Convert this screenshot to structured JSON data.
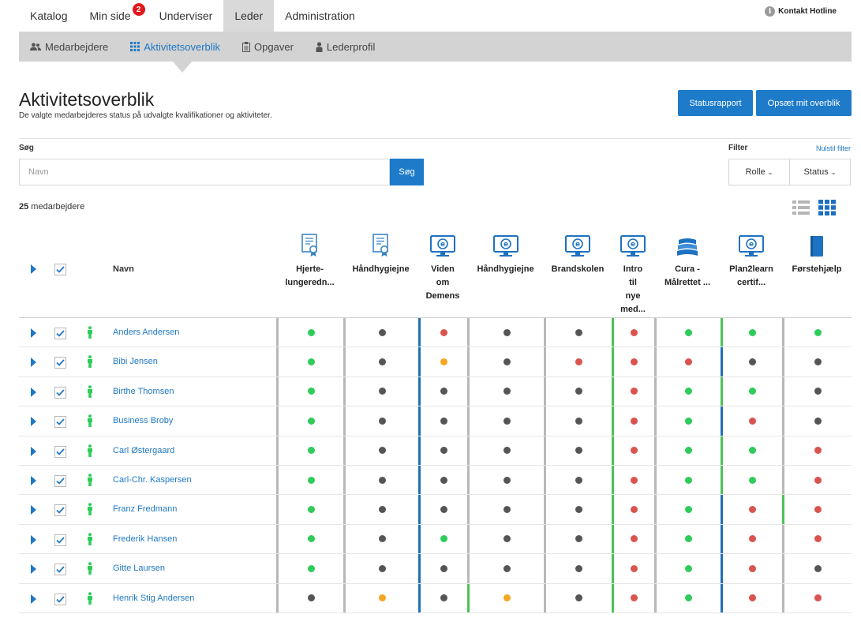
{
  "topnav": {
    "tabs": [
      {
        "label": "Katalog"
      },
      {
        "label": "Min side",
        "badge": "2"
      },
      {
        "label": "Underviser"
      },
      {
        "label": "Leder",
        "active": true
      },
      {
        "label": "Administration"
      }
    ],
    "hotline": "Kontakt Hotline"
  },
  "subnav": {
    "items": [
      {
        "label": "Medarbejdere",
        "icon": "users-icon"
      },
      {
        "label": "Aktivitetsoverblik",
        "icon": "grid-icon",
        "active": true
      },
      {
        "label": "Opgaver",
        "icon": "clipboard-icon"
      },
      {
        "label": "Lederprofil",
        "icon": "user-icon"
      }
    ]
  },
  "header": {
    "title": "Aktivitetsoverblik",
    "subtitle": "De valgte medarbejderes status på udvalgte kvalifikationer og aktiviteter.",
    "status_report": "Statusrapport",
    "setup_overview": "Opsæt mit overblik"
  },
  "search": {
    "label": "Søg",
    "placeholder": "Navn",
    "button": "Søg"
  },
  "filter": {
    "label": "Filter",
    "reset": "Nulstil filter",
    "role": "Rolle",
    "status": "Status"
  },
  "count": {
    "number": "25",
    "text": " medarbejdere"
  },
  "colors": {
    "green": "#2ecc5a",
    "red": "#d9534f",
    "gray": "#555555",
    "orange": "#f5a623",
    "border_gray": "#b8b8b8",
    "border_blue": "#1f6fb5",
    "border_green": "#4cc257",
    "accent": "#1d7bc9"
  },
  "table": {
    "name_header": "Navn",
    "columns": [
      {
        "label": "Hjerte-\nlungeredn...",
        "icon": "certificate-icon"
      },
      {
        "label": "Håndhygiejne",
        "icon": "certificate-icon"
      },
      {
        "label": "Viden\nom\nDemens",
        "icon": "elearning-icon"
      },
      {
        "label": "Håndhygiejne",
        "icon": "elearning-icon"
      },
      {
        "label": "Brandskolen",
        "icon": "elearning-icon"
      },
      {
        "label": "Intro\ntil\nnye\nmed...",
        "icon": "elearning-icon"
      },
      {
        "label": "Cura -\nMålrettet ...",
        "icon": "books-icon"
      },
      {
        "label": "Plan2learn\ncertif...",
        "icon": "elearning-icon"
      },
      {
        "label": "Førstehjælp",
        "icon": "book-icon"
      }
    ],
    "rows": [
      {
        "name": "Anders Andersen",
        "cells": [
          "green",
          "gray",
          "red",
          "gray",
          "gray",
          "red",
          "green",
          "green",
          "green"
        ],
        "borders": [
          "gray",
          "gray",
          "blue",
          "gray",
          "gray",
          "green",
          "gray",
          "green",
          "gray"
        ]
      },
      {
        "name": "Bibi Jensen",
        "cells": [
          "green",
          "gray",
          "orange",
          "gray",
          "red",
          "red",
          "red",
          "gray",
          "gray"
        ],
        "borders": [
          "gray",
          "gray",
          "blue",
          "gray",
          "gray",
          "green",
          "gray",
          "blue",
          "gray"
        ]
      },
      {
        "name": "Birthe Thomsen",
        "cells": [
          "green",
          "gray",
          "gray",
          "gray",
          "gray",
          "red",
          "green",
          "green",
          "gray"
        ],
        "borders": [
          "gray",
          "gray",
          "blue",
          "gray",
          "gray",
          "green",
          "gray",
          "green",
          "gray"
        ]
      },
      {
        "name": "Business Broby",
        "cells": [
          "green",
          "gray",
          "gray",
          "gray",
          "gray",
          "red",
          "green",
          "red",
          "gray"
        ],
        "borders": [
          "gray",
          "gray",
          "blue",
          "gray",
          "gray",
          "green",
          "gray",
          "blue",
          "gray"
        ]
      },
      {
        "name": "Carl Østergaard",
        "cells": [
          "green",
          "gray",
          "gray",
          "gray",
          "gray",
          "red",
          "green",
          "green",
          "red"
        ],
        "borders": [
          "gray",
          "gray",
          "blue",
          "gray",
          "gray",
          "green",
          "gray",
          "green",
          "gray"
        ]
      },
      {
        "name": "Carl-Chr. Kaspersen",
        "cells": [
          "green",
          "gray",
          "gray",
          "gray",
          "gray",
          "red",
          "green",
          "green",
          "red"
        ],
        "borders": [
          "gray",
          "gray",
          "blue",
          "gray",
          "gray",
          "green",
          "gray",
          "green",
          "gray"
        ]
      },
      {
        "name": "Franz Fredmann",
        "cells": [
          "green",
          "gray",
          "gray",
          "gray",
          "gray",
          "red",
          "green",
          "red",
          "red"
        ],
        "borders": [
          "gray",
          "gray",
          "blue",
          "gray",
          "gray",
          "green",
          "gray",
          "blue",
          "green"
        ]
      },
      {
        "name": "Frederik Hansen",
        "cells": [
          "green",
          "gray",
          "green",
          "gray",
          "gray",
          "red",
          "green",
          "red",
          "red"
        ],
        "borders": [
          "gray",
          "gray",
          "blue",
          "gray",
          "gray",
          "green",
          "gray",
          "blue",
          "gray"
        ]
      },
      {
        "name": "Gitte Laursen",
        "cells": [
          "green",
          "gray",
          "gray",
          "gray",
          "gray",
          "red",
          "green",
          "red",
          "gray"
        ],
        "borders": [
          "gray",
          "gray",
          "blue",
          "gray",
          "gray",
          "green",
          "gray",
          "blue",
          "gray"
        ]
      },
      {
        "name": "Henrik Stig Andersen",
        "cells": [
          "gray",
          "orange",
          "gray",
          "orange",
          "gray",
          "red",
          "green",
          "red",
          "red"
        ],
        "borders": [
          "gray",
          "gray",
          "blue",
          "green",
          "gray",
          "green",
          "gray",
          "blue",
          "gray"
        ]
      }
    ]
  }
}
